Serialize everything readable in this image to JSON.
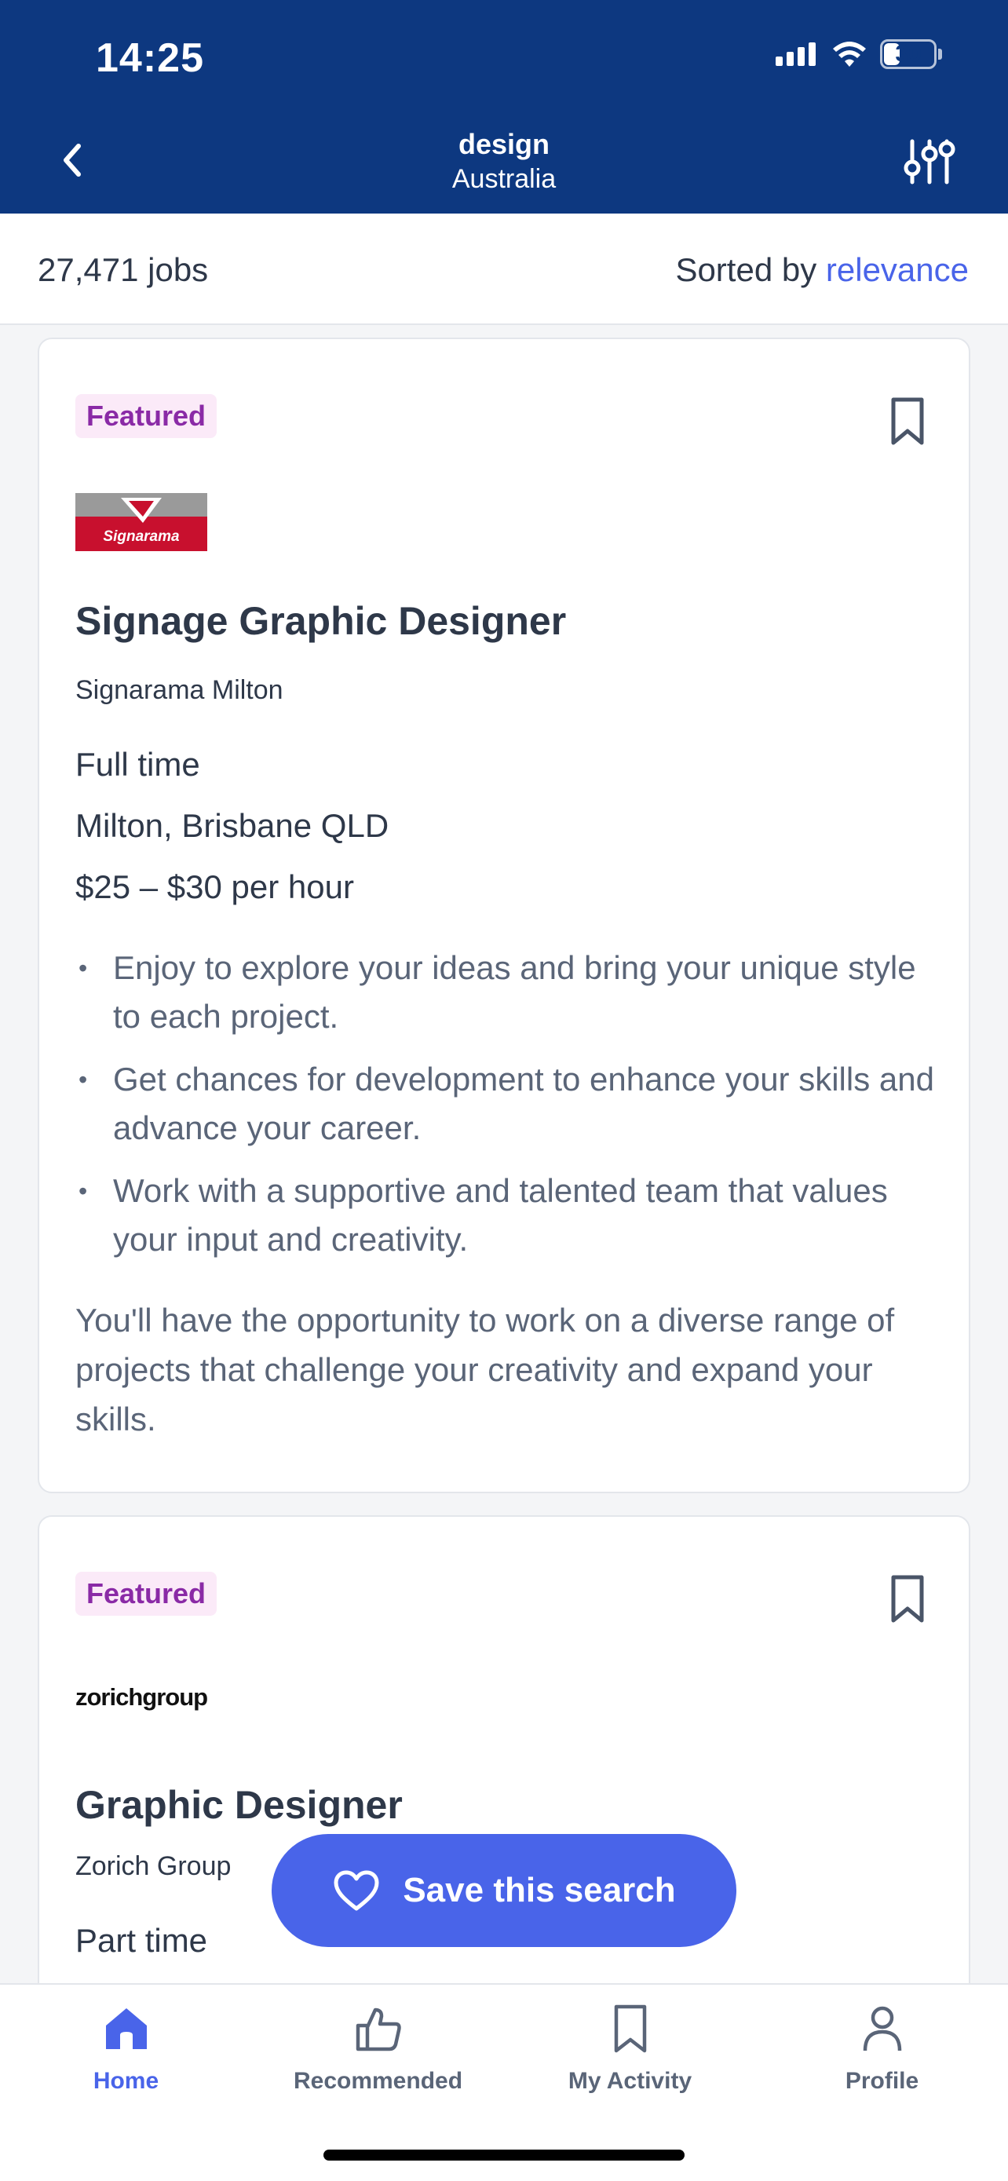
{
  "status": {
    "time": "14:25",
    "battery": "30"
  },
  "header": {
    "title": "design",
    "subtitle": "Australia",
    "back_icon": "chevron-left-icon",
    "filter_icon": "sliders-icon"
  },
  "summary": {
    "job_count": "27,471 jobs",
    "sort_prefix": "Sorted by ",
    "sort_value": "relevance"
  },
  "jobs": [
    {
      "badge": "Featured",
      "logo_text": "Signarama",
      "title": "Signage Graphic Designer",
      "company": "Signarama Milton",
      "work_type": "Full time",
      "location": "Milton, Brisbane QLD",
      "salary": "$25 – $30 per hour",
      "bullets": [
        "Enjoy to explore your ideas and bring your unique style to each project.",
        "Get chances for development to enhance your skills and advance your career.",
        "Work with a supportive and talented team that values your input and creativity."
      ],
      "description": "You'll have the opportunity to work on a diverse range of projects that challenge your creativity and expand your skills."
    },
    {
      "badge": "Featured",
      "logo_text": "zorichgroup",
      "title": "Graphic Designer",
      "company": "Zorich Group",
      "work_type": "Part time"
    }
  ],
  "save_search": {
    "label": "Save this search",
    "icon": "heart-icon"
  },
  "tabs": [
    {
      "label": "Home",
      "icon": "home-icon",
      "active": true
    },
    {
      "label": "Recommended",
      "icon": "thumbs-up-icon",
      "active": false
    },
    {
      "label": "My Activity",
      "icon": "bookmark-icon",
      "active": false
    },
    {
      "label": "Profile",
      "icon": "person-icon",
      "active": false
    }
  ],
  "colors": {
    "header_bg": "#0d3880",
    "accent": "#4964e9",
    "badge_bg": "#fbeaf8",
    "badge_text": "#8a2aa6",
    "text": "#2e3849",
    "muted": "#5a6578"
  }
}
